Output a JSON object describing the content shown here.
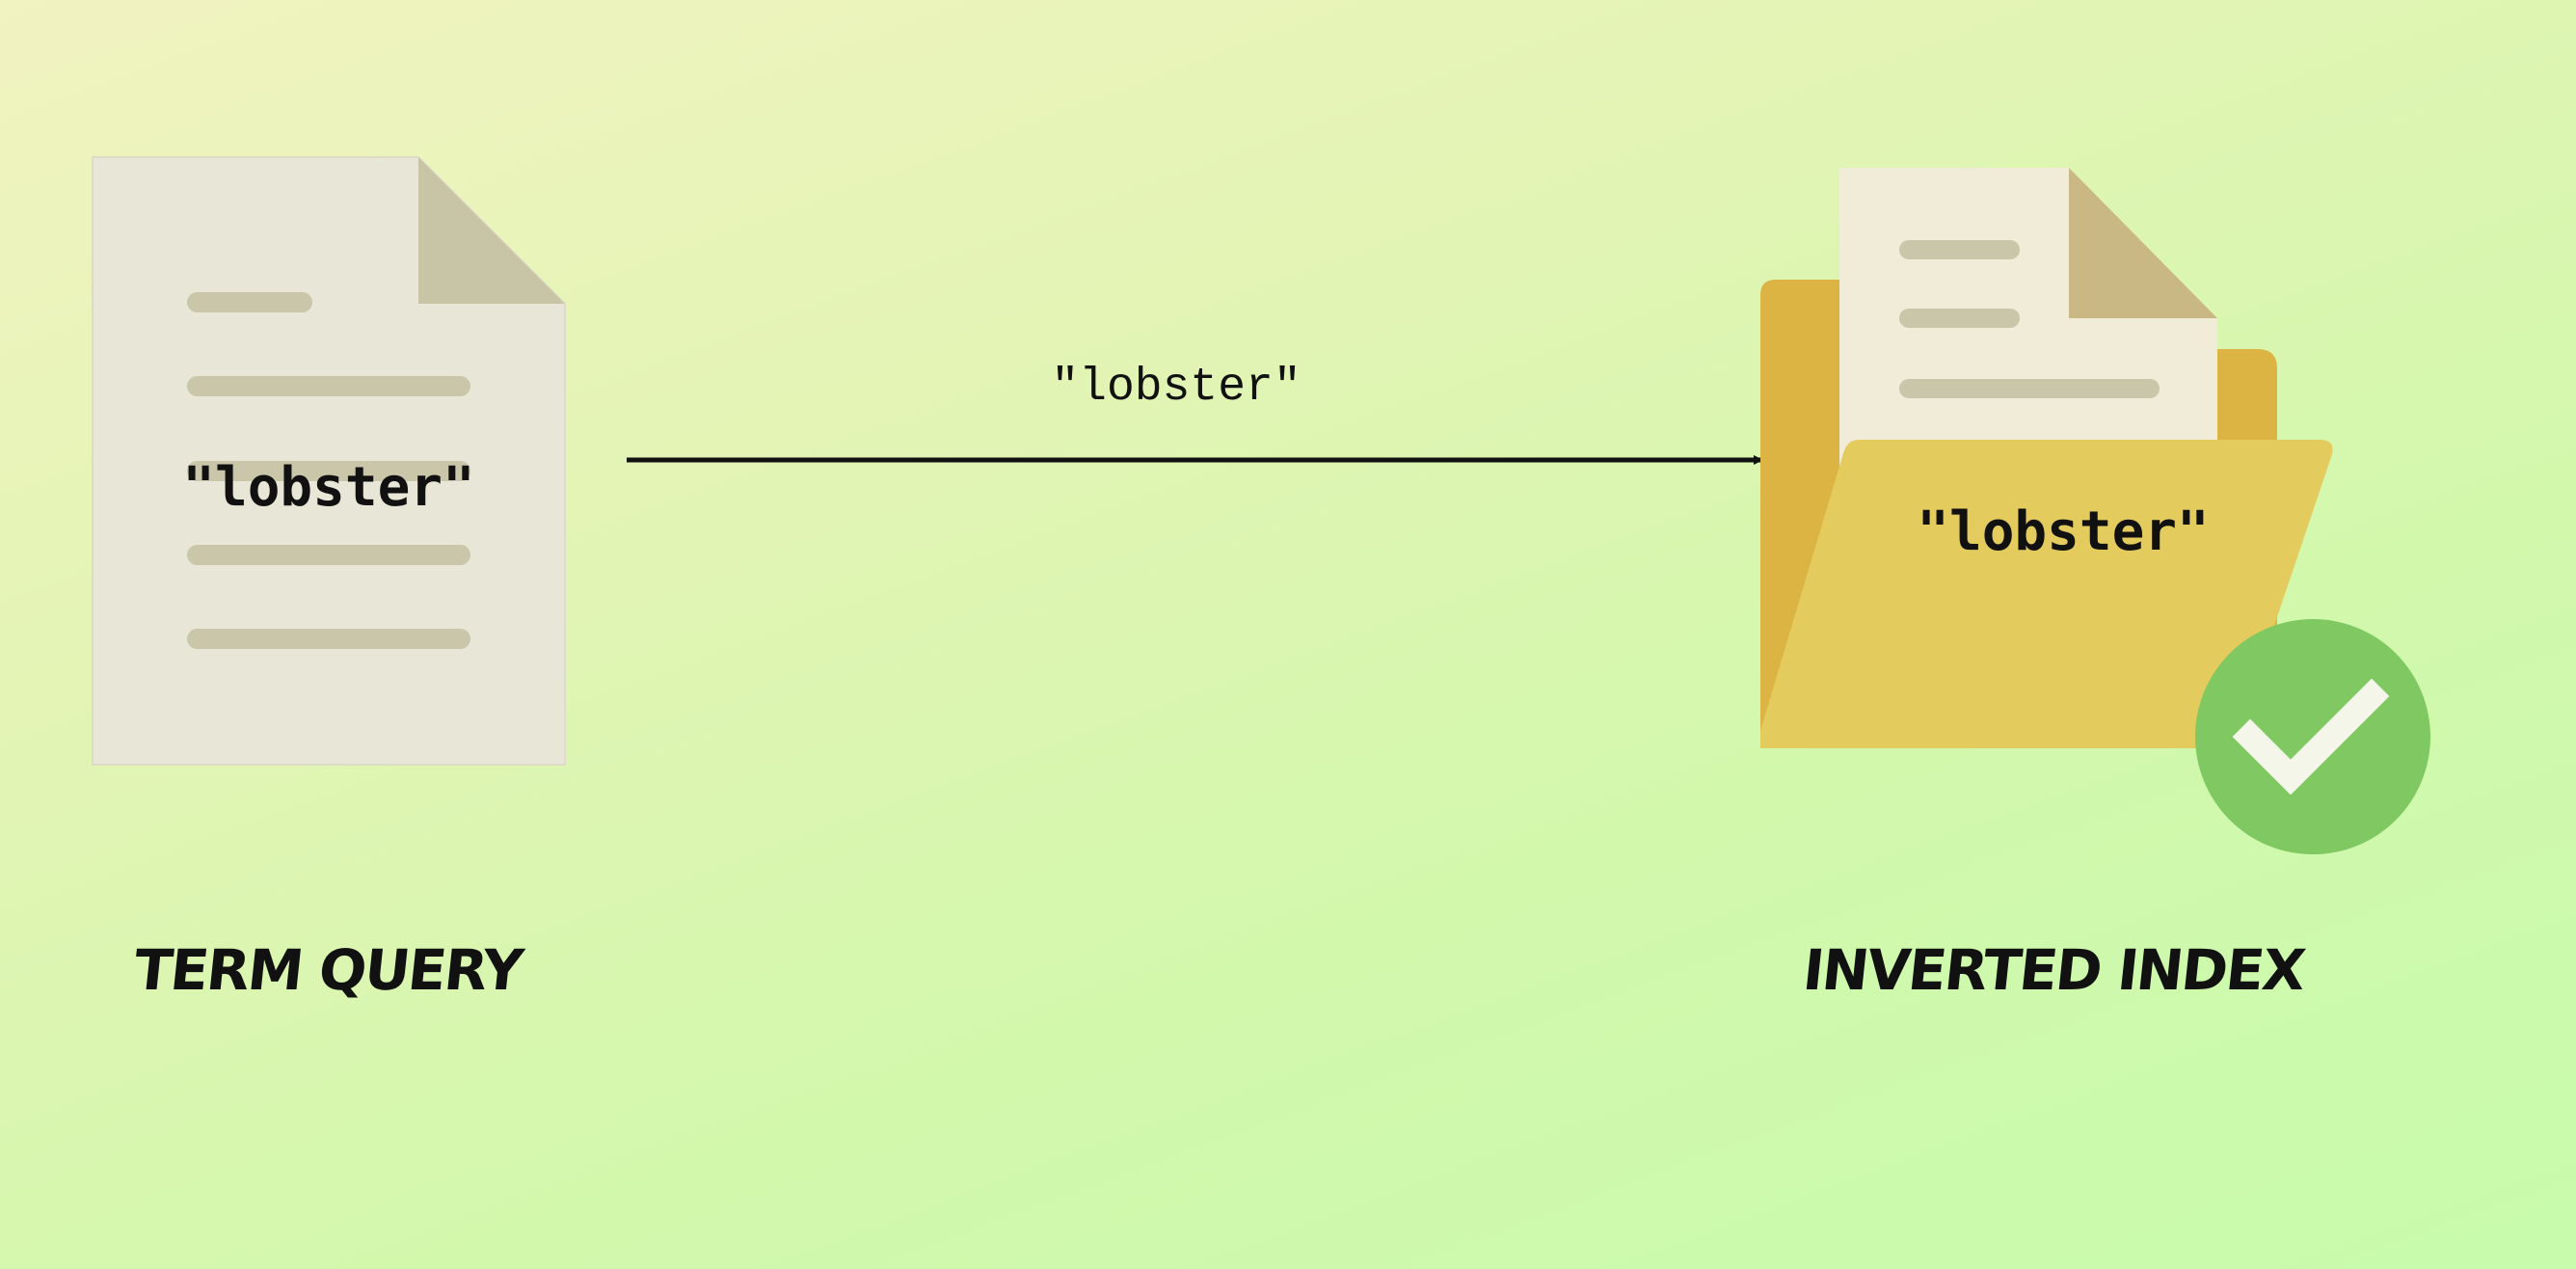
{
  "source_document": {
    "icon": "document-icon",
    "term": "\"lobster\""
  },
  "arrow": {
    "icon": "arrow-right-icon",
    "label": "\"lobster\""
  },
  "inverted_index": {
    "icon": "open-folder-icon",
    "term": "\"lobster\"",
    "status_icon": "checkmark-circle-icon"
  },
  "captions": {
    "left": "TERM QUERY",
    "right": "INVERTED INDEX"
  },
  "colors": {
    "paper": "#e8e6d6",
    "paper_fold": "#c8c5a6",
    "paper_lines": "#c9c6aa",
    "folder_back": "#dcb444",
    "folder_front": "#e3cb5d",
    "check_circle": "#7fc862",
    "arrow": "#111111"
  }
}
